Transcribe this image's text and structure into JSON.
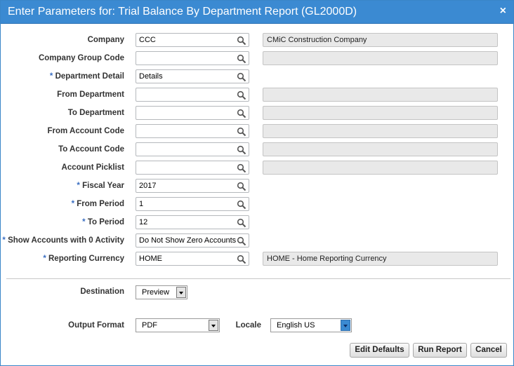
{
  "dialog": {
    "title": "Enter Parameters for: Trial Balance By Department Report (GL2000D)",
    "close_glyph": "×"
  },
  "fields": [
    {
      "label": "Company",
      "required": false,
      "value": "CCC",
      "description": "CMiC Construction Company",
      "has_description": true
    },
    {
      "label": "Company Group Code",
      "required": false,
      "value": "",
      "description": "",
      "has_description": true
    },
    {
      "label": "Department Detail",
      "required": true,
      "value": "Details",
      "description": "",
      "has_description": false
    },
    {
      "label": "From Department",
      "required": false,
      "value": "",
      "description": "",
      "has_description": true
    },
    {
      "label": "To Department",
      "required": false,
      "value": "",
      "description": "",
      "has_description": true
    },
    {
      "label": "From Account Code",
      "required": false,
      "value": "",
      "description": "",
      "has_description": true
    },
    {
      "label": "To Account Code",
      "required": false,
      "value": "",
      "description": "",
      "has_description": true
    },
    {
      "label": "Account Picklist",
      "required": false,
      "value": "",
      "description": "",
      "has_description": true
    },
    {
      "label": "Fiscal Year",
      "required": true,
      "value": "2017",
      "description": "",
      "has_description": false
    },
    {
      "label": "From Period",
      "required": true,
      "value": "1",
      "description": "",
      "has_description": false
    },
    {
      "label": "To Period",
      "required": true,
      "value": "12",
      "description": "",
      "has_description": false
    },
    {
      "label": "Show Accounts with 0 Activity",
      "required": true,
      "value": "Do Not Show Zero Accounts",
      "description": "",
      "has_description": false
    },
    {
      "label": "Reporting Currency",
      "required": true,
      "value": "HOME",
      "description": "HOME - Home Reporting Currency",
      "has_description": true
    }
  ],
  "required_marker": "*",
  "destination": {
    "label": "Destination",
    "value": "Preview"
  },
  "output_format": {
    "label": "Output Format",
    "value": "PDF"
  },
  "locale": {
    "label": "Locale",
    "value": "English US"
  },
  "buttons": {
    "edit_defaults": "Edit Defaults",
    "run_report": "Run Report",
    "cancel": "Cancel"
  },
  "icons": {
    "lookup": "magnifier-icon",
    "close": "close-icon",
    "dropdown": "chevron-down-icon"
  },
  "colors": {
    "titlebar": "#3b8ad2",
    "required": "#3b6fc2",
    "locale_arrow": "#3b8ad2"
  }
}
